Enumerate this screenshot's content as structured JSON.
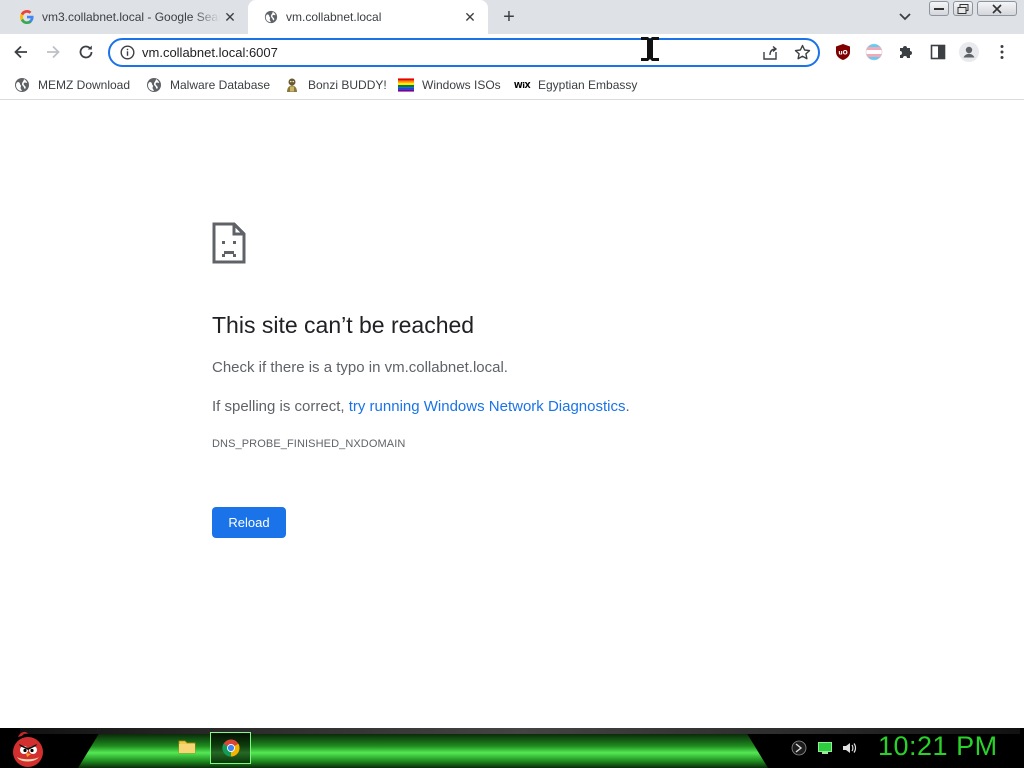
{
  "browser": {
    "tabs": [
      {
        "title": "vm3.collabnet.local - Google Search",
        "favicon": "google-icon",
        "active": false
      },
      {
        "title": "vm.collabnet.local",
        "favicon": "globe-icon",
        "active": true
      }
    ],
    "address": {
      "url": "vm.collabnet.local:6007"
    },
    "bookmarks": [
      {
        "label": "MEMZ Download",
        "icon": "globe-icon"
      },
      {
        "label": "Malware Database",
        "icon": "globe-icon"
      },
      {
        "label": "Bonzi BUDDY!",
        "icon": "bonzi-icon"
      },
      {
        "label": "Windows ISOs",
        "icon": "rainbow-flag-icon"
      },
      {
        "label": "Egyptian Embassy",
        "icon": "wix-icon",
        "icon_text": "WiX"
      }
    ]
  },
  "error_page": {
    "title": "This site can’t be reached",
    "line1": "Check if there is a typo in vm.collabnet.local.",
    "line2_prefix": "If spelling is correct, ",
    "line2_link": "try running Windows Network Diagnostics",
    "line2_suffix": ".",
    "error_code": "DNS_PROBE_FINISHED_NXDOMAIN",
    "reload_label": "Reload"
  },
  "taskbar": {
    "clock": "10:21 PM"
  },
  "colors": {
    "accent": "#1a73e8",
    "clock_green": "#28d228",
    "taskbar_green": "#54e854"
  }
}
